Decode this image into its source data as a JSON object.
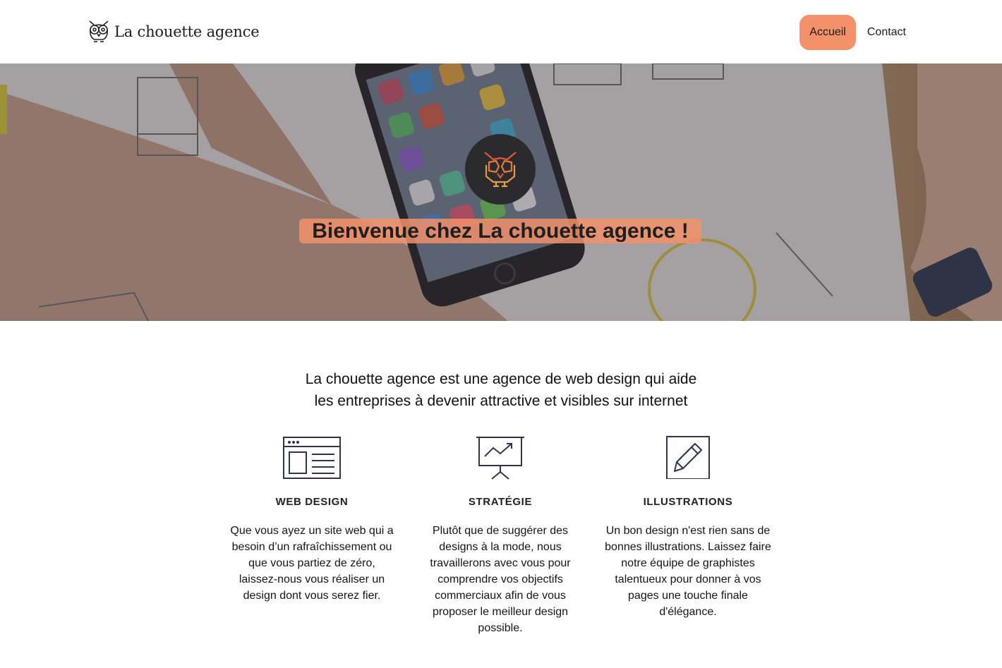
{
  "header": {
    "logo_text": "La chouette agence",
    "logo_icon": "owl-icon",
    "nav": [
      {
        "label": "Accueil",
        "active": true
      },
      {
        "label": "Contact",
        "active": false
      }
    ]
  },
  "hero": {
    "badge_icon": "owl-icon",
    "title": "Bienvenue chez La chouette agence !"
  },
  "intro": {
    "line1": "La chouette agence est une agence de web design qui aide",
    "line2": "les entreprises à devenir attractive et visibles sur internet"
  },
  "services": [
    {
      "icon": "web-browser-icon",
      "title": "WEB DESIGN",
      "lines": [
        "Que vous ayez un site web qui a",
        "besoin d’un rafraîchissement ou",
        "que vous partiez de zéro,",
        "laissez-nous vous réaliser un",
        "design dont vous serez fier."
      ]
    },
    {
      "icon": "presentation-chart-icon",
      "title": "STRATÉGIE",
      "lines": [
        "Plutôt que de suggérer des",
        "designs à la mode, nous",
        "travaillerons avec vous pour",
        "comprendre vos objectifs",
        "commerciaux afin de vous",
        "proposer le meilleur design",
        "possible."
      ]
    },
    {
      "icon": "pencil-square-icon",
      "title": "ILLUSTRATIONS",
      "lines": [
        "Un bon design n'est rien sans de",
        "bonnes illustrations. Laissez faire",
        "notre équipe de graphistes",
        "talentueux pour donner à vos",
        "pages une touche finale",
        "d'élégance."
      ]
    }
  ],
  "colors": {
    "accent": "#f2916a",
    "icon_stroke": "#2e3553",
    "badge_bg": "#2b2b2d"
  }
}
